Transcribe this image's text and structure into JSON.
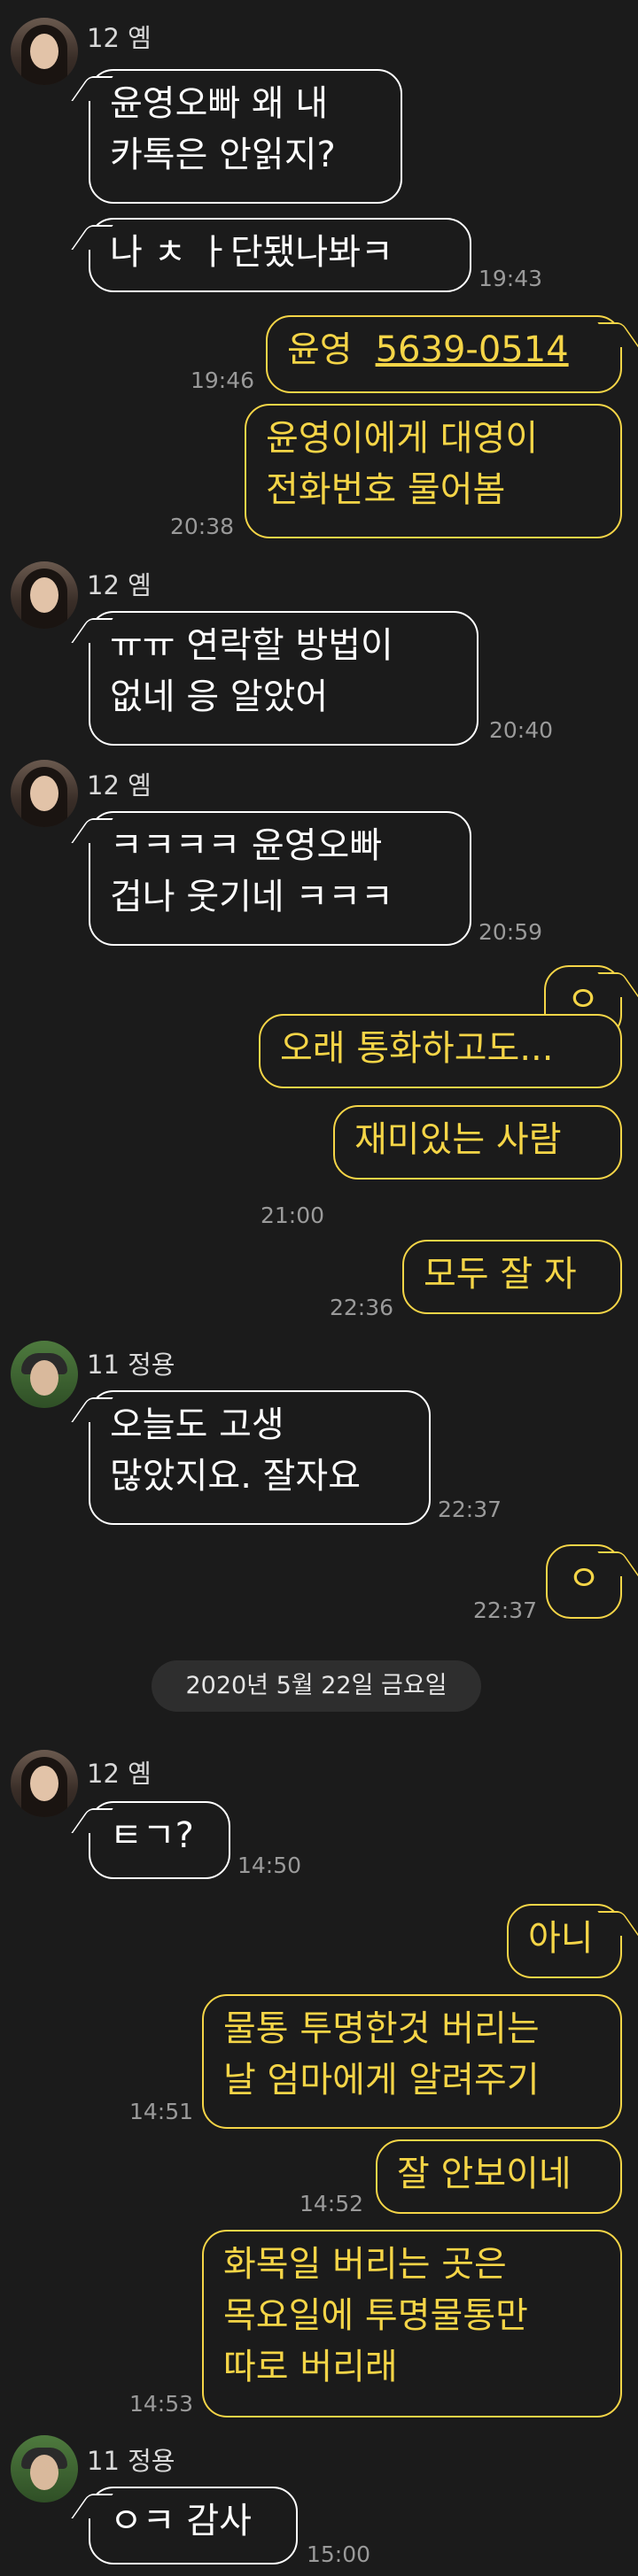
{
  "date_divider": "2020년 5월 22일 금요일",
  "messages": [
    {
      "sender": "12 옘",
      "text": "윤영오빠 왜 내\n카톡은 안읽지?"
    },
    {
      "text": "나 ㅊ ㅏ단됐나봐ㅋ",
      "time": "19:43"
    },
    {
      "text": "윤영",
      "phone": "5639-0514",
      "time": "19:46"
    },
    {
      "text": "윤영이에게 대영이\n전화번호 물어봄",
      "time": "20:38"
    },
    {
      "sender": "12 옘",
      "text": "ㅠㅠ 연락할 방법이\n없네 응 알았어",
      "time": "20:40"
    },
    {
      "sender": "12 옘",
      "text": "ㅋㅋㅋㅋ 윤영오빠\n겁나 웃기네 ㅋㅋㅋ",
      "time": "20:59"
    },
    {
      "text": "ㅇ"
    },
    {
      "text": "오래 통화하고도..."
    },
    {
      "text": "재미있는 사람",
      "time": "21:00"
    },
    {
      "text": "모두 잘 자",
      "time": "22:36"
    },
    {
      "sender": "11 정용",
      "text": "오늘도 고생\n많았지요. 잘자요",
      "time": "22:37"
    },
    {
      "text": "ㅇ",
      "time": "22:37"
    },
    {
      "sender": "12 옘",
      "text": "ㅌㄱ?",
      "time": "14:50"
    },
    {
      "text": "아니"
    },
    {
      "text": "물통 투명한것 버리는\n날 엄마에게 알려주기",
      "time": "14:51"
    },
    {
      "text": "잘 안보이네",
      "time": "14:52"
    },
    {
      "text": "화목일 버리는 곳은\n목요일에 투명물통만\n따로 버리래",
      "time": "14:53"
    },
    {
      "sender": "11 정용",
      "text": "ㅇㅋ 감사",
      "time": "15:00"
    }
  ]
}
